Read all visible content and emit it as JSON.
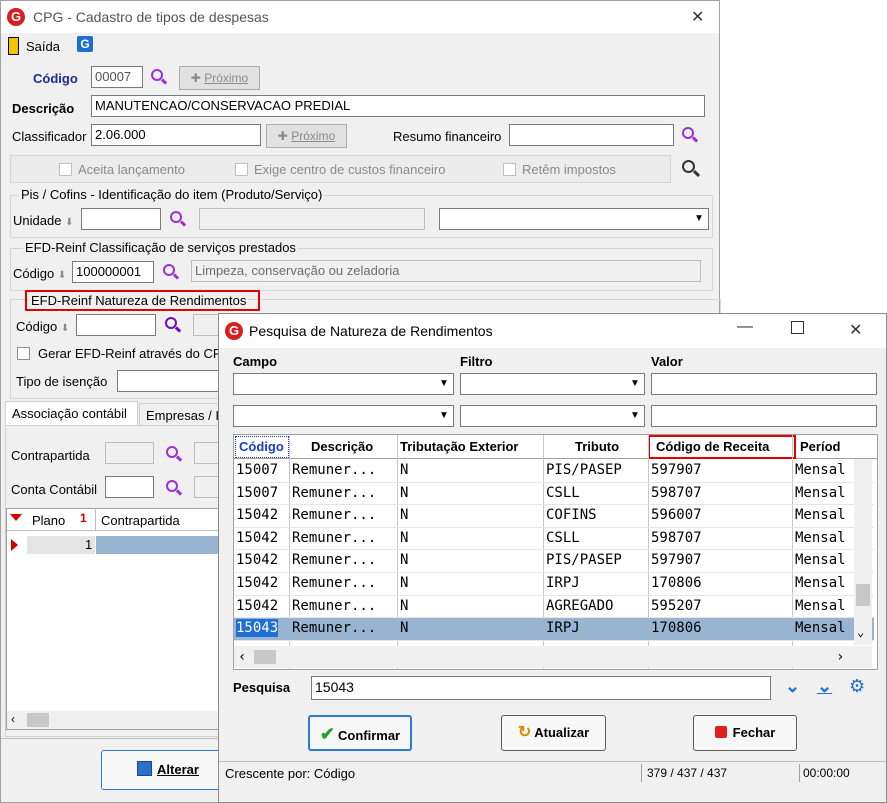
{
  "main_window": {
    "title": "CPG - Cadastro de tipos de despesas",
    "toolbar": {
      "exit_label": "Saída"
    },
    "codigo": {
      "label": "Código",
      "value": "00007",
      "next_label": "Próximo"
    },
    "descricao": {
      "label": "Descrição",
      "value": "MANUTENCAO/CONSERVACAO PREDIAL"
    },
    "classificador": {
      "label": "Classificador",
      "value": "2.06.000",
      "next_label": "Próximo"
    },
    "resumo_financeiro": {
      "label": "Resumo financeiro",
      "value": ""
    },
    "checks": {
      "aceita": "Aceita lançamento",
      "exige": "Exige centro de custos financeiro",
      "retem": "Retêm impostos"
    },
    "pis_cofins": {
      "title": "Pis / Cofins - Identificação do item (Produto/Serviço)",
      "unidade_label": "Unidade"
    },
    "efd_class": {
      "title": "EFD-Reinf Classificação de serviços prestados",
      "codigo_label": "Código",
      "codigo_value": "100000001",
      "desc_value": "Limpeza, conservação ou zeladoria"
    },
    "efd_natureza": {
      "title": "EFD-Reinf Natureza de Rendimentos",
      "codigo_label": "Código",
      "gerar_label": "Gerar EFD-Reinf através do CF",
      "tipo_isencao_label": "Tipo de isenção"
    },
    "tabs": {
      "assoc": "Associação contábil",
      "empresas": "Empresas / I"
    },
    "contrapartida_label": "Contrapartida",
    "conta_contabil_label": "Conta Contábil",
    "table": {
      "plano_header": "Plano",
      "contrapartida_header": "Contrapartida",
      "row_value": "1"
    },
    "alterar_label": "Alterar"
  },
  "dialog": {
    "title": "Pesquisa de Natureza de Rendimentos",
    "filter_headers": {
      "campo": "Campo",
      "filtro": "Filtro",
      "valor": "Valor"
    },
    "columns": [
      "Código",
      "Descrição",
      "Tributação Exterior",
      "Tributo",
      "Código de Receita",
      "Períod"
    ],
    "rows": [
      [
        "15007",
        "Remuner...",
        "N",
        "PIS/PASEP",
        "597907",
        "Mensal"
      ],
      [
        "15007",
        "Remuner...",
        "N",
        "CSLL",
        "598707",
        "Mensal"
      ],
      [
        "15042",
        "Remuner...",
        "N",
        "COFINS",
        "596007",
        "Mensal"
      ],
      [
        "15042",
        "Remuner...",
        "N",
        "CSLL",
        "598707",
        "Mensal"
      ],
      [
        "15042",
        "Remuner...",
        "N",
        "PIS/PASEP",
        "597907",
        "Mensal"
      ],
      [
        "15042",
        "Remuner...",
        "N",
        "IRPJ",
        "170806",
        "Mensal"
      ],
      [
        "15042",
        "Remuner...",
        "N",
        "AGREGADO",
        "595207",
        "Mensal"
      ],
      [
        "15043",
        "Remuner...",
        "N",
        "IRPJ",
        "170806",
        "Mensal"
      ]
    ],
    "pesquisa_label": "Pesquisa",
    "pesquisa_value": "15043",
    "buttons": {
      "confirmar": "Confirmar",
      "atualizar": "Atualizar",
      "fechar": "Fechar"
    },
    "status": {
      "order": "Crescente por: Código",
      "count": "379 / 437 / 437",
      "time": "00:00:00"
    }
  }
}
